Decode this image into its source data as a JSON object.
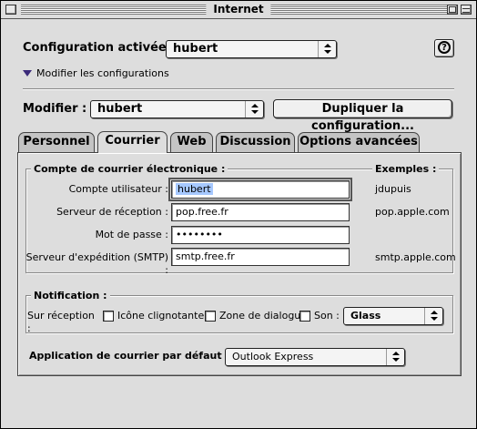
{
  "window": {
    "title": "Internet"
  },
  "header": {
    "config_label": "Configuration activée :",
    "config_value": "hubert",
    "help_glyph": "?",
    "modify_configs_link": "Modifier les configurations"
  },
  "modify_row": {
    "label": "Modifier :",
    "value": "hubert",
    "duplicate_button": "Dupliquer la configuration..."
  },
  "tabs": [
    {
      "label": "Personnel",
      "active": false
    },
    {
      "label": "Courrier",
      "active": true
    },
    {
      "label": "Web",
      "active": false
    },
    {
      "label": "Discussion",
      "active": false
    },
    {
      "label": "Options avancées",
      "active": false
    }
  ],
  "account": {
    "title": "Compte de courrier électronique :",
    "examples_title": "Exemples :",
    "fields": [
      {
        "label": "Compte utilisateur :",
        "value": "hubert",
        "example": "jdupuis"
      },
      {
        "label": "Serveur de réception :",
        "value": "pop.free.fr",
        "example": "pop.apple.com"
      },
      {
        "label": "Mot de passe :",
        "value": "••••••••",
        "example": ""
      },
      {
        "label": "Serveur d'expédition (SMTP) :",
        "value": "smtp.free.fr",
        "example": "smtp.apple.com"
      }
    ]
  },
  "notification": {
    "title": "Notification :",
    "on_receive_label": "Sur réception :",
    "options": [
      {
        "label": "Icône clignotante",
        "checked": false
      },
      {
        "label": "Zone de dialogue",
        "checked": false
      },
      {
        "label": "Son :",
        "checked": false
      }
    ],
    "sound_value": "Glass"
  },
  "default_app": {
    "label": "Application de courrier par défaut :",
    "value": "Outlook Express"
  },
  "colors": {
    "window_bg": "#dddddd",
    "selection": "#a6c8ff",
    "disclosure": "#3b2a7a"
  }
}
